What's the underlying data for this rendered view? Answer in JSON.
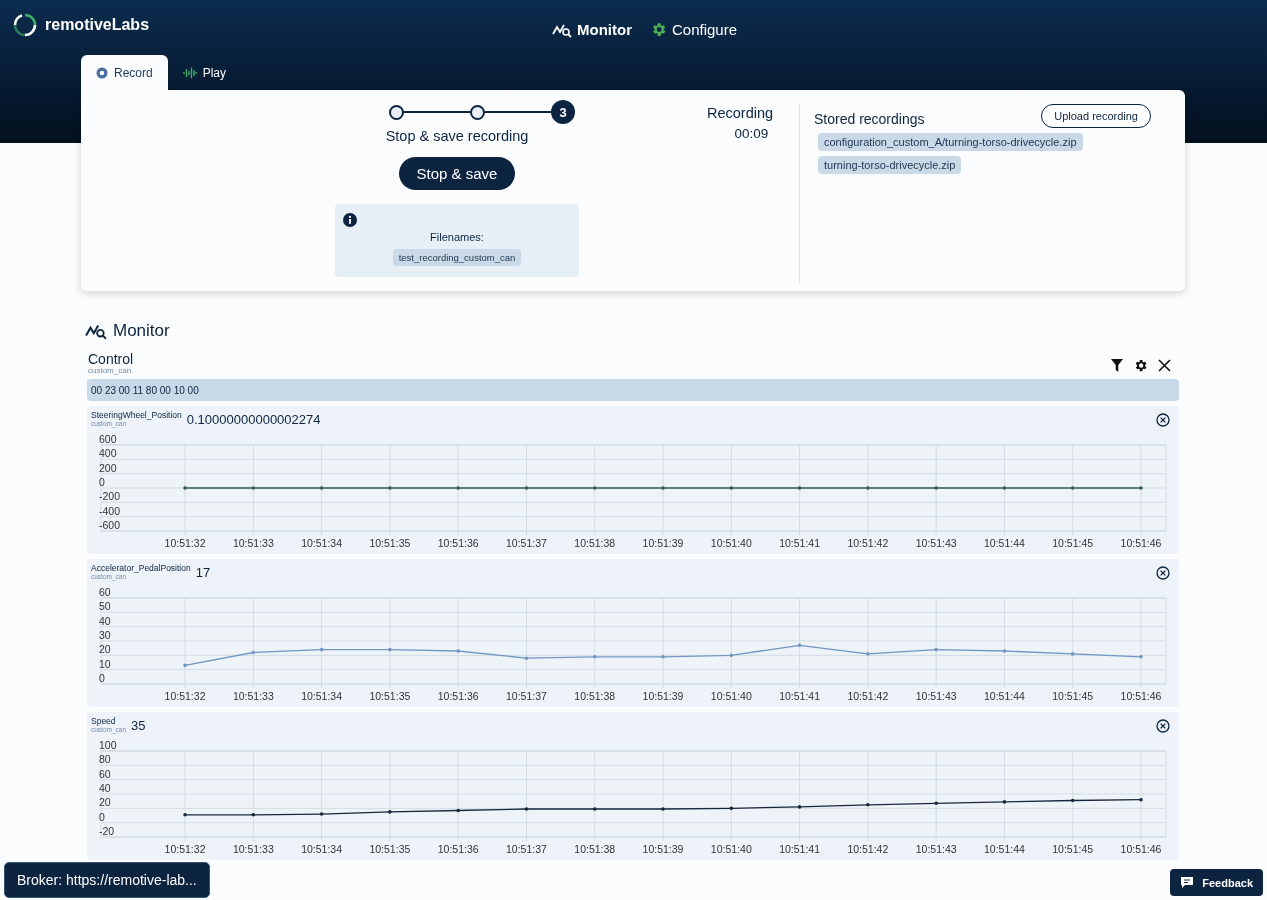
{
  "header": {
    "logo": "remotiveLabs",
    "nav": [
      {
        "label": "Monitor",
        "selected": true
      },
      {
        "label": "Configure",
        "selected": false
      }
    ]
  },
  "tabs": [
    {
      "label": "Record",
      "selected": true
    },
    {
      "label": "Play",
      "selected": false
    }
  ],
  "stepper": {
    "steps": [
      {
        "kind": "done"
      },
      {
        "kind": "done"
      },
      {
        "kind": "current",
        "number": "3"
      }
    ],
    "label": "Stop & save recording"
  },
  "stop_button": "Stop & save",
  "info": {
    "title": "Filenames:",
    "files": [
      "test_recording_custom_can"
    ]
  },
  "recording": {
    "label": "Recording",
    "time": "00:09"
  },
  "stored": {
    "title": "Stored recordings",
    "upload_button": "Upload recording",
    "files": [
      "configuration_custom_A/turning-torso-drivecycle.zip",
      "turning-torso-drivecycle.zip"
    ]
  },
  "monitor": {
    "title": "Monitor",
    "panel": {
      "name": "Control",
      "namespace": "custom_can",
      "raw": "00 23 00 11 80 00 10 00",
      "signals": [
        {
          "name": "SteeringWheel_Position",
          "namespace": "custom_can",
          "value": "0.10000000000002274",
          "chart_data": {
            "type": "line",
            "categories": [
              "10:51:32",
              "10:51:33",
              "10:51:34",
              "10:51:35",
              "10:51:36",
              "10:51:37",
              "10:51:38",
              "10:51:39",
              "10:51:40",
              "10:51:41",
              "10:51:42",
              "10:51:43",
              "10:51:44",
              "10:51:45",
              "10:51:46"
            ],
            "series": [
              {
                "color": "#2f5d4f",
                "values": [
                  0,
                  0,
                  0,
                  0,
                  0,
                  0,
                  0,
                  0,
                  0,
                  0,
                  0,
                  0,
                  0,
                  0,
                  0
                ]
              }
            ],
            "ylim": [
              -600,
              600
            ],
            "yticks": [
              -600,
              -400,
              -200,
              0,
              200,
              400,
              600
            ],
            "grid": true
          }
        },
        {
          "name": "Accelerator_PedalPosition",
          "namespace": "custom_can",
          "value": "17",
          "chart_data": {
            "type": "line",
            "categories": [
              "10:51:32",
              "10:51:33",
              "10:51:34",
              "10:51:35",
              "10:51:36",
              "10:51:37",
              "10:51:38",
              "10:51:39",
              "10:51:40",
              "10:51:41",
              "10:51:42",
              "10:51:43",
              "10:51:44",
              "10:51:45",
              "10:51:46"
            ],
            "series": [
              {
                "color": "#6f97c4",
                "values": [
                  13,
                  22,
                  24,
                  24,
                  23,
                  18,
                  19,
                  19,
                  20,
                  27,
                  21,
                  24,
                  23,
                  21,
                  19
                ]
              }
            ],
            "ylim": [
              0,
              60
            ],
            "yticks": [
              0,
              10,
              20,
              30,
              40,
              50,
              60
            ],
            "grid": true
          }
        },
        {
          "name": "Speed",
          "namespace": "custom_can",
          "value": "35",
          "chart_data": {
            "type": "line",
            "categories": [
              "10:51:32",
              "10:51:33",
              "10:51:34",
              "10:51:35",
              "10:51:36",
              "10:51:37",
              "10:51:38",
              "10:51:39",
              "10:51:40",
              "10:51:41",
              "10:51:42",
              "10:51:43",
              "10:51:44",
              "10:51:45",
              "10:51:46"
            ],
            "series": [
              {
                "color": "#17283b",
                "values": [
                  11,
                  11,
                  12,
                  15,
                  17,
                  19,
                  19,
                  19,
                  20,
                  22,
                  25,
                  27,
                  29,
                  31,
                  32
                ]
              }
            ],
            "ylim": [
              -20,
              100
            ],
            "yticks": [
              -20,
              0,
              20,
              40,
              60,
              80,
              100
            ],
            "grid": true
          }
        }
      ]
    }
  },
  "broker": "Broker: https://remotive-lab...",
  "feedback": "Feedback"
}
